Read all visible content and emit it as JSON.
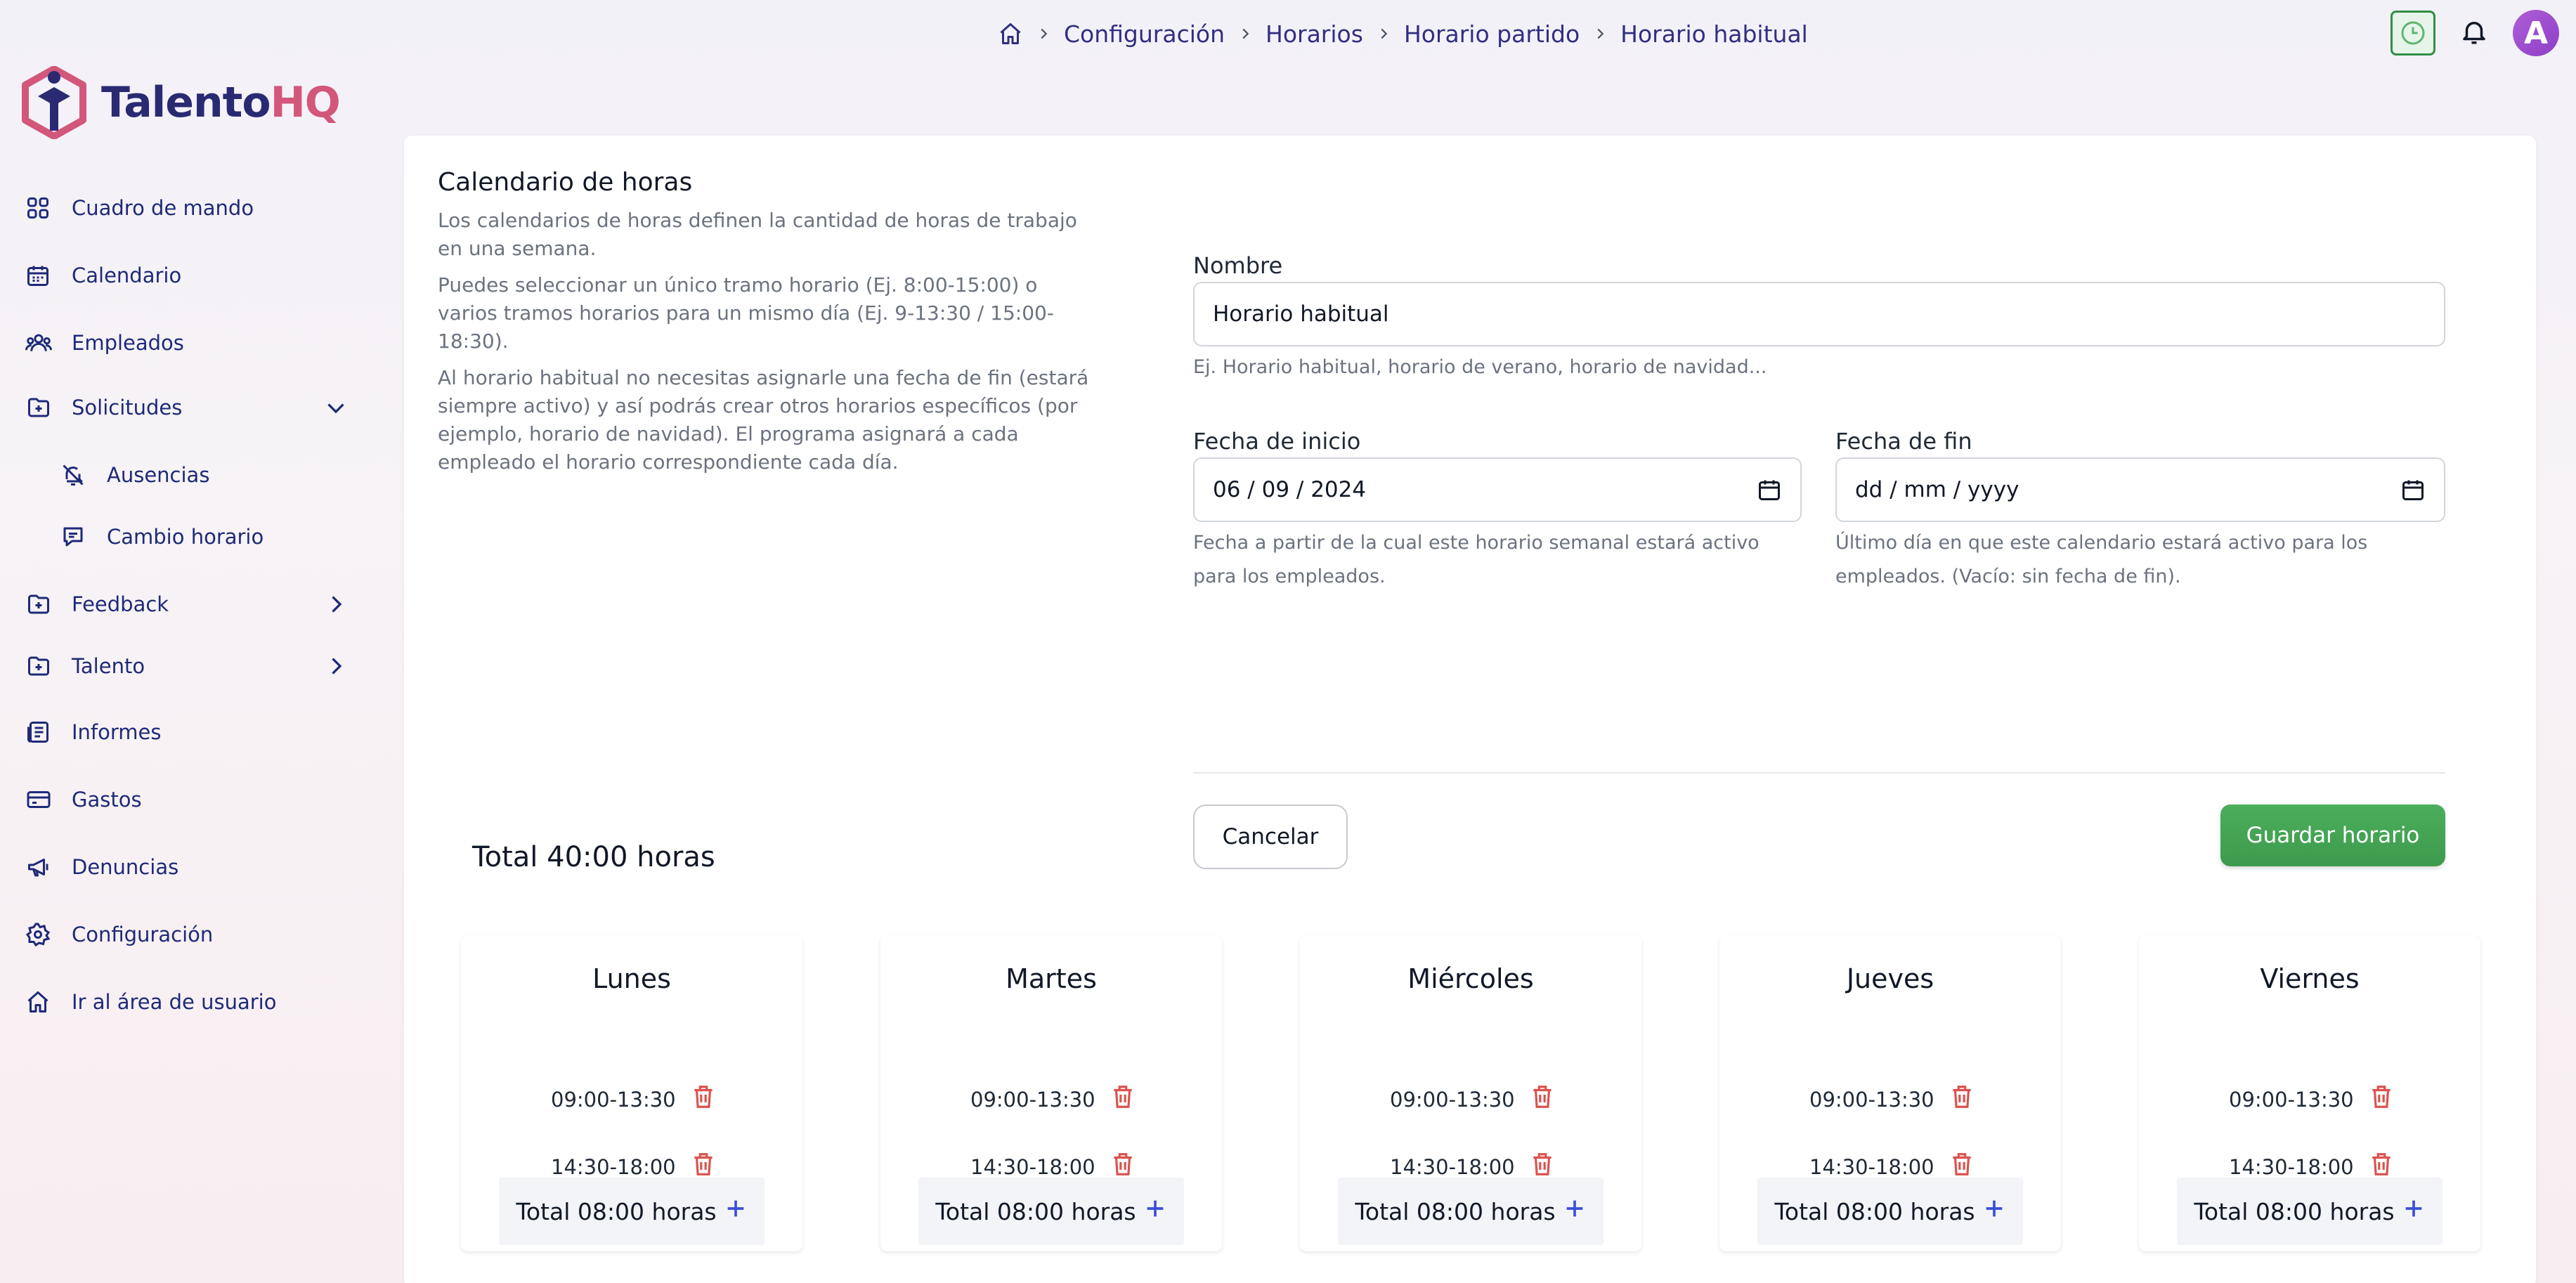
{
  "breadcrumb": {
    "items": [
      "Configuración",
      "Horarios",
      "Horario partido",
      "Horario habitual"
    ]
  },
  "brand": {
    "part1": "Talento",
    "part2": "HQ"
  },
  "user": {
    "initial": "A"
  },
  "sidebar": {
    "items": [
      {
        "label": "Cuadro de mando",
        "icon": "grid-icon"
      },
      {
        "label": "Calendario",
        "icon": "calendar-icon"
      },
      {
        "label": "Empleados",
        "icon": "users-icon"
      },
      {
        "label": "Solicitudes",
        "icon": "folder-plus-icon",
        "expanded": true
      },
      {
        "label": "Ausencias",
        "icon": "bell-off-icon"
      },
      {
        "label": "Cambio horario",
        "icon": "message-icon"
      },
      {
        "label": "Feedback",
        "icon": "folder-plus-icon"
      },
      {
        "label": "Talento",
        "icon": "folder-plus-icon"
      },
      {
        "label": "Informes",
        "icon": "report-icon"
      },
      {
        "label": "Gastos",
        "icon": "card-icon"
      },
      {
        "label": "Denuncias",
        "icon": "megaphone-icon"
      },
      {
        "label": "Configuración",
        "icon": "gear-icon"
      },
      {
        "label": "Ir al área de usuario",
        "icon": "home-icon"
      }
    ]
  },
  "intro": {
    "title": "Calendario de horas",
    "p1": "Los calendarios de horas definen la cantidad de horas de trabajo en una semana.",
    "p2": "Puedes seleccionar un único tramo horario (Ej. 8:00-15:00) o varios tramos horarios para un mismo día (Ej. 9-13:30 / 15:00-18:30).",
    "p3": "Al horario habitual no necesitas asignarle una fecha de fin (estará siempre activo) y así podrás crear otros horarios específicos (por ejemplo, horario de navidad). El programa asignará a cada empleado el horario correspondiente cada día."
  },
  "form": {
    "name_label": "Nombre",
    "name_value": "Horario habitual",
    "name_hint": "Ej. Horario habitual, horario de verano, horario de navidad...",
    "start_label": "Fecha de inicio",
    "start_value": "06 / 09 / 2024",
    "start_hint": "Fecha a partir de la cual este horario semanal estará activo para los empleados.",
    "end_label": "Fecha de fin",
    "end_value": "dd / mm / yyyy",
    "end_hint": "Último día en que este calendario estará activo para los empleados. (Vacío: sin fecha de fin).",
    "cancel": "Cancelar",
    "save": "Guardar horario"
  },
  "week_total": "Total 40:00 horas",
  "days": [
    {
      "name": "Lunes",
      "slots": [
        "09:00-13:30",
        "14:30-18:00"
      ],
      "total": "Total 08:00 horas"
    },
    {
      "name": "Martes",
      "slots": [
        "09:00-13:30",
        "14:30-18:00"
      ],
      "total": "Total 08:00 horas"
    },
    {
      "name": "Miércoles",
      "slots": [
        "09:00-13:30",
        "14:30-18:00"
      ],
      "total": "Total 08:00 horas"
    },
    {
      "name": "Jueves",
      "slots": [
        "09:00-13:30",
        "14:30-18:00"
      ],
      "total": "Total 08:00 horas"
    },
    {
      "name": "Viernes",
      "slots": [
        "09:00-13:30",
        "14:30-18:00"
      ],
      "total": "Total 08:00 horas"
    }
  ],
  "colors": {
    "accent": "#1e2a78",
    "save": "#43a553",
    "trash": "#d9534f",
    "plus": "#3b4ed8"
  }
}
